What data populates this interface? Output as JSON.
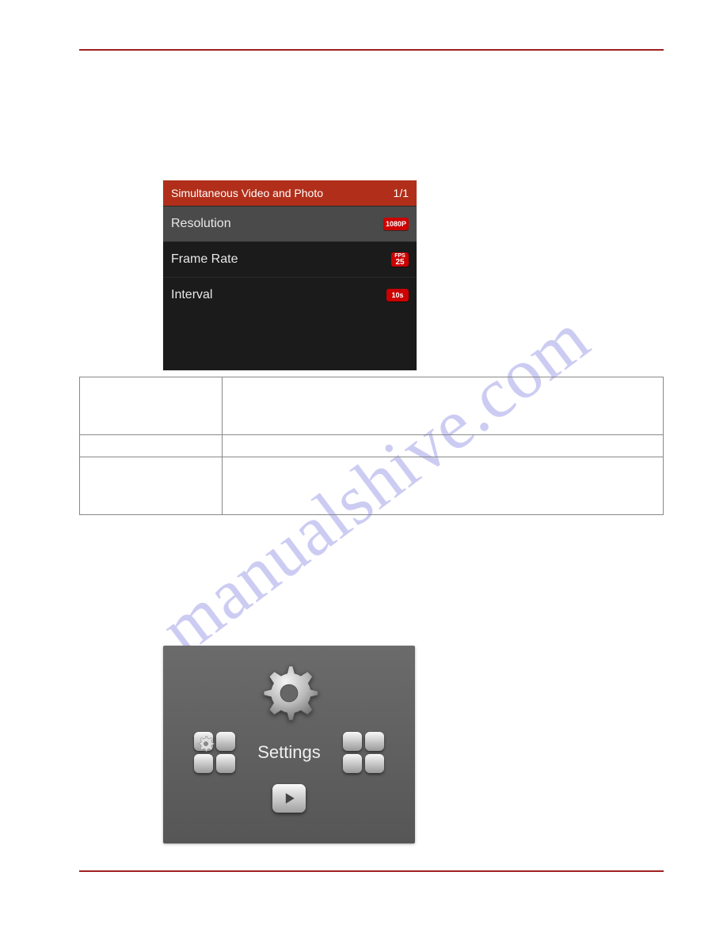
{
  "watermark": "manualshive.com",
  "device_menu": {
    "title": "Simultaneous Video and Photo",
    "page_indicator": "1/1",
    "rows": [
      {
        "label": "Resolution",
        "badge": "1080P"
      },
      {
        "label": "Frame Rate",
        "fps_label": "FPS",
        "fps_value": "25"
      },
      {
        "label": "Interval",
        "badge": "10s"
      }
    ]
  },
  "carousel": {
    "center_label": "Settings"
  }
}
